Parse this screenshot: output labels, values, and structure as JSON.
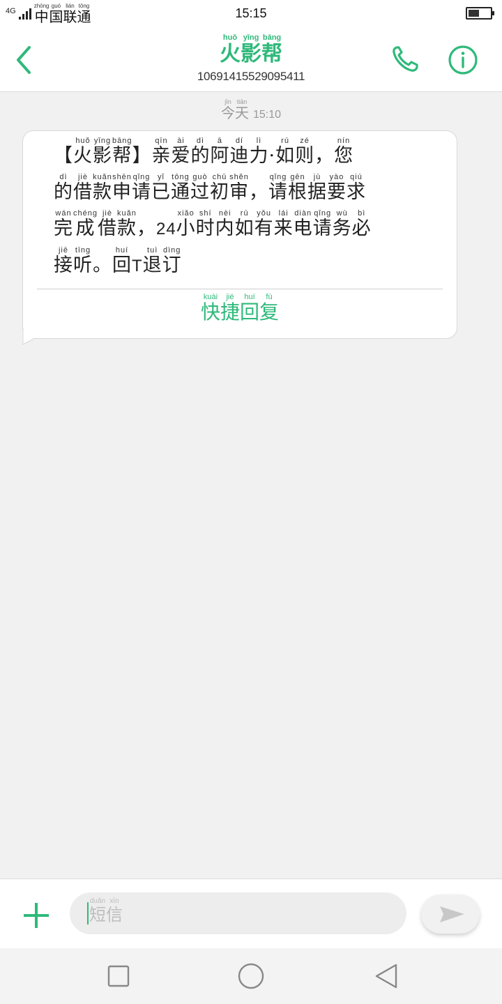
{
  "status_bar": {
    "network": "4G",
    "carrier": [
      "中",
      "国",
      "联",
      "通"
    ],
    "carrier_pinyin": [
      "zhōng",
      "guó",
      "lián",
      "tōng"
    ],
    "time": "15:15",
    "battery_level": 0.5
  },
  "header": {
    "title": [
      "火",
      "影",
      "帮"
    ],
    "title_pinyin": [
      "huǒ",
      "yǐng",
      "bāng"
    ],
    "phone_number": "10691415529095411",
    "back_icon": "chevron-left-icon",
    "call_icon": "phone-icon",
    "info_icon": "info-icon",
    "accent_color": "#2fb97a"
  },
  "conversation": {
    "date_label": [
      "今",
      "天"
    ],
    "date_pinyin": [
      "jīn",
      "tiān"
    ],
    "date_time": "15:10",
    "message_lines": [
      [
        [
          "【",
          ""
        ],
        [
          "火",
          "huǒ"
        ],
        [
          "影",
          "yǐng"
        ],
        [
          "帮",
          "bāng"
        ],
        [
          "】",
          ""
        ],
        [
          "亲",
          "qīn"
        ],
        [
          "爱",
          "ài"
        ],
        [
          "的",
          "dì"
        ],
        [
          "阿",
          "ā"
        ],
        [
          "迪",
          "dí"
        ],
        [
          "力",
          "lì"
        ],
        [
          "·",
          ""
        ],
        [
          "如",
          "rú"
        ],
        [
          "则",
          "zé"
        ],
        [
          "，",
          ""
        ],
        [
          "您",
          "nín"
        ]
      ],
      [
        [
          "的",
          "dì"
        ],
        [
          "借",
          "jiè"
        ],
        [
          "款",
          "kuǎn"
        ],
        [
          "申",
          "shēn"
        ],
        [
          "请",
          "qǐng"
        ],
        [
          "已",
          "yǐ"
        ],
        [
          "通",
          "tōng"
        ],
        [
          "过",
          "guò"
        ],
        [
          "初",
          "chū"
        ],
        [
          "审",
          "shěn"
        ],
        [
          "，",
          ""
        ],
        [
          "请",
          "qǐng"
        ],
        [
          "根",
          "gēn"
        ],
        [
          "据",
          "jù"
        ],
        [
          "要",
          "yào"
        ],
        [
          "求",
          "qiú"
        ]
      ],
      [
        [
          "完",
          "wán"
        ],
        [
          "成",
          "chéng"
        ],
        [
          "借",
          "jiè"
        ],
        [
          "款",
          "kuǎn"
        ],
        [
          "，",
          ""
        ],
        [
          "24",
          ""
        ],
        [
          "小",
          "xiǎo"
        ],
        [
          "时",
          "shí"
        ],
        [
          "内",
          "nèi"
        ],
        [
          "如",
          "rú"
        ],
        [
          "有",
          "yǒu"
        ],
        [
          "来",
          "lái"
        ],
        [
          "电",
          "diàn"
        ],
        [
          "请",
          "qǐng"
        ],
        [
          "务",
          "wù"
        ],
        [
          "必",
          "bì"
        ]
      ],
      [
        [
          "接",
          "jiē"
        ],
        [
          "听",
          "tīng"
        ],
        [
          "。",
          ""
        ],
        [
          "回",
          "huí"
        ],
        [
          "T",
          ""
        ],
        [
          "退",
          "tuì"
        ],
        [
          "订",
          "dìng"
        ]
      ]
    ],
    "quick_reply": [
      "快",
      "捷",
      "回",
      "复"
    ],
    "quick_reply_pinyin": [
      "kuài",
      "jié",
      "huí",
      "fù"
    ]
  },
  "input_bar": {
    "add_icon": "plus-icon",
    "placeholder": [
      "短",
      "信"
    ],
    "placeholder_pinyin": [
      "duǎn",
      "xìn"
    ],
    "send_icon": "send-icon"
  },
  "nav_bar": {
    "recent_icon": "square-icon",
    "home_icon": "circle-icon",
    "back_icon": "triangle-back-icon"
  }
}
